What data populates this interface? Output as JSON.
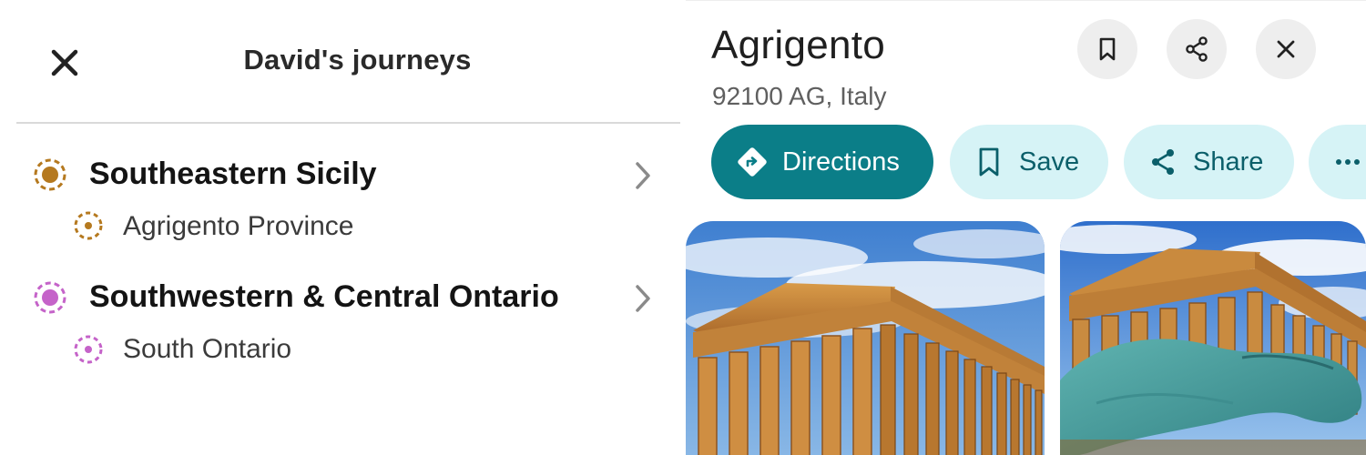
{
  "journeys_panel": {
    "title": "David's journeys",
    "close_icon": "close-icon",
    "groups": [
      {
        "title": "Southeastern Sicily",
        "color": "#b5791f",
        "chevron_icon": "chevron-right-icon",
        "items": [
          {
            "label": "Agrigento Province"
          }
        ]
      },
      {
        "title": "Southwestern & Central Ontario",
        "color": "#c563c9",
        "chevron_icon": "chevron-right-icon",
        "items": [
          {
            "label": "South Ontario"
          }
        ]
      }
    ]
  },
  "place_panel": {
    "name": "Agrigento",
    "address": "92100 AG, Italy",
    "header_icons": [
      "bookmark-icon",
      "share-icon",
      "close-icon"
    ],
    "actions": [
      {
        "label": "Directions",
        "icon": "directions-icon",
        "primary": true
      },
      {
        "label": "Save",
        "icon": "bookmark-icon",
        "primary": false
      },
      {
        "label": "Share",
        "icon": "share-icon",
        "primary": false
      },
      {
        "label": "",
        "icon": "more-icon",
        "primary": false
      }
    ],
    "photos": [
      {
        "subject": "temple-photo"
      },
      {
        "subject": "temple-statue-photo"
      }
    ],
    "colors": {
      "primary": "#0b7e88",
      "secondary_bg": "#d6f3f6",
      "secondary_text": "#0b5f6a"
    }
  }
}
